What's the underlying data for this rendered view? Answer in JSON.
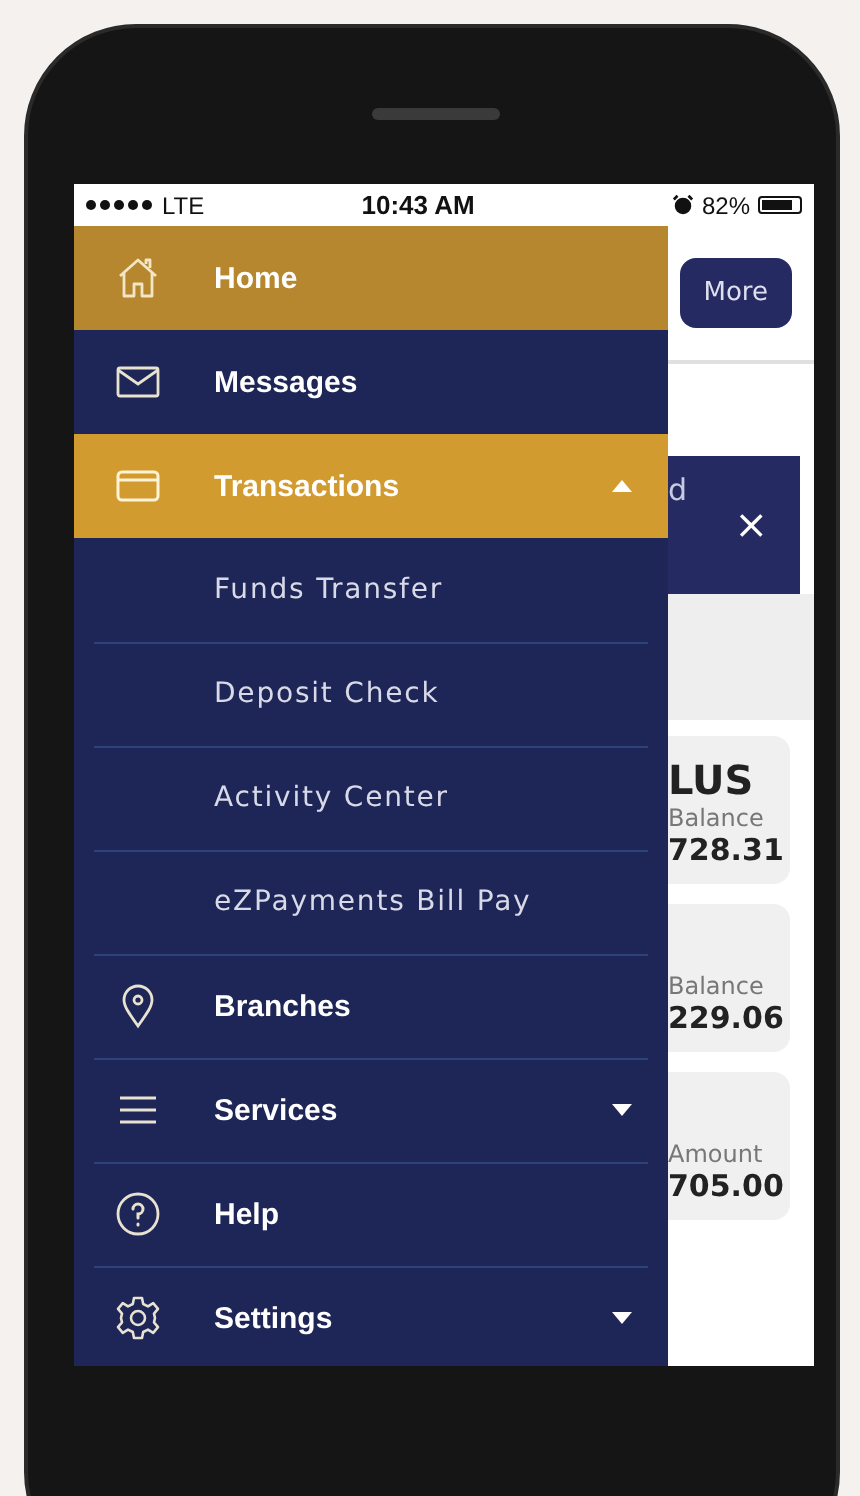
{
  "status_bar": {
    "network": "LTE",
    "time": "10:43 AM",
    "battery": "82%"
  },
  "background_app": {
    "more_button": "More",
    "banner_text": "d",
    "banner_close": "×",
    "cards": [
      {
        "title": "LUS",
        "label": "Balance",
        "amount": "728.31"
      },
      {
        "label": "Balance",
        "amount": "229.06"
      },
      {
        "label": "Amount",
        "amount": "705.00"
      }
    ]
  },
  "menu": {
    "items": [
      {
        "label": "Home",
        "selected": true
      },
      {
        "label": "Messages",
        "selected": false
      },
      {
        "label": "Transactions",
        "selected": false,
        "expanded": true,
        "children": [
          {
            "label": "Funds Transfer"
          },
          {
            "label": "Deposit Check"
          },
          {
            "label": "Activity Center"
          },
          {
            "label": "eZPayments Bill Pay"
          }
        ]
      },
      {
        "label": "Branches",
        "selected": false
      },
      {
        "label": "Services",
        "selected": false,
        "expanded": false
      },
      {
        "label": "Help",
        "selected": false
      },
      {
        "label": "Settings",
        "selected": false,
        "expanded": false
      }
    ]
  }
}
